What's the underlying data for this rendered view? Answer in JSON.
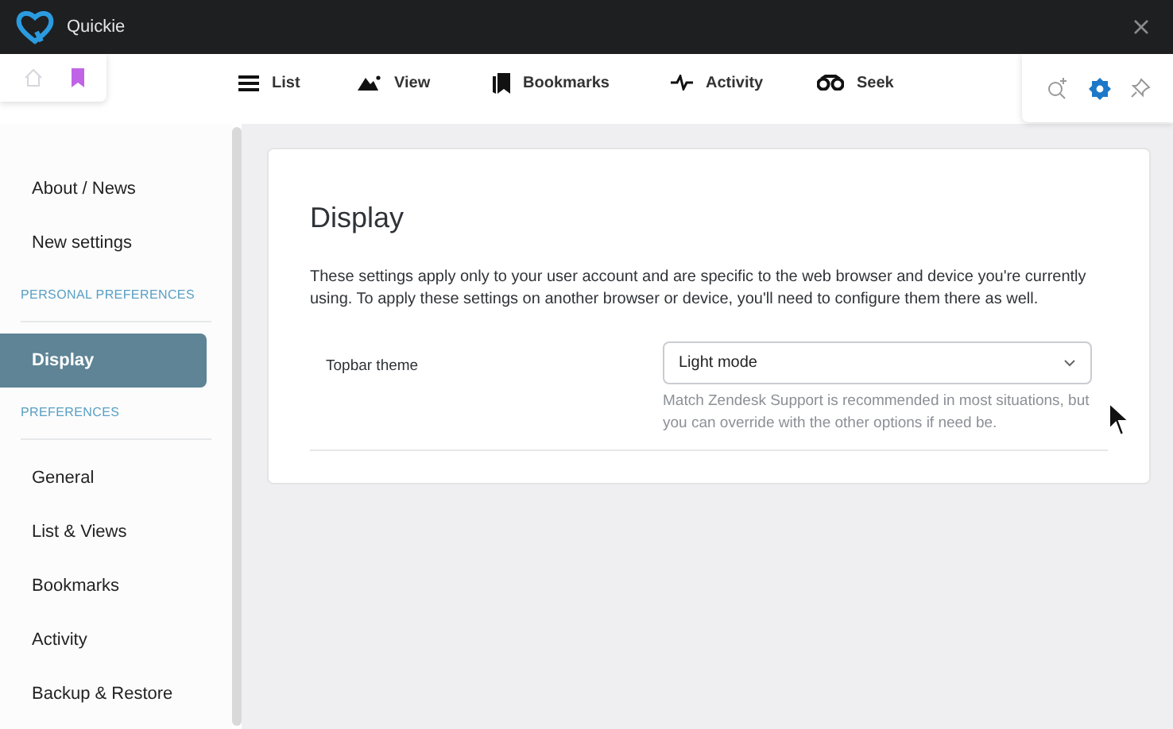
{
  "window": {
    "title": "Quickie"
  },
  "left_tools": [
    {
      "kind": "home"
    },
    {
      "kind": "bookmark"
    }
  ],
  "nav": [
    {
      "kind": "list",
      "label": "List"
    },
    {
      "kind": "view",
      "label": "View"
    },
    {
      "kind": "bookmarks",
      "label": "Bookmarks"
    },
    {
      "kind": "activity",
      "label": "Activity"
    },
    {
      "kind": "seek",
      "label": "Seek"
    }
  ],
  "right_tools": [
    {
      "kind": "search-plus"
    },
    {
      "kind": "settings"
    },
    {
      "kind": "pin"
    }
  ],
  "sidebar": {
    "items": [
      {
        "kind": "item",
        "label": "About / News",
        "selected": false
      },
      {
        "kind": "item",
        "label": "New settings",
        "selected": false
      },
      {
        "kind": "header",
        "label": "PERSONAL PREFERENCES"
      },
      {
        "kind": "item",
        "label": "Display",
        "selected": true
      },
      {
        "kind": "header",
        "label": "PREFERENCES"
      },
      {
        "kind": "item",
        "label": "General",
        "selected": false
      },
      {
        "kind": "item",
        "label": "List & Views",
        "selected": false
      },
      {
        "kind": "item",
        "label": "Bookmarks",
        "selected": false
      },
      {
        "kind": "item",
        "label": "Activity",
        "selected": false
      },
      {
        "kind": "item",
        "label": "Backup & Restore",
        "selected": false
      }
    ]
  },
  "panel": {
    "title": "Display",
    "description": "These settings apply only to your user account and are specific to the web browser and device you're currently using. To apply these settings on another browser or device, you'll need to configure them there as well.",
    "settings": [
      {
        "label": "Topbar theme",
        "value": "Light mode",
        "hint": "Match Zendesk Support is recommended in most situations, but you can override with the other options if need be."
      }
    ]
  }
}
